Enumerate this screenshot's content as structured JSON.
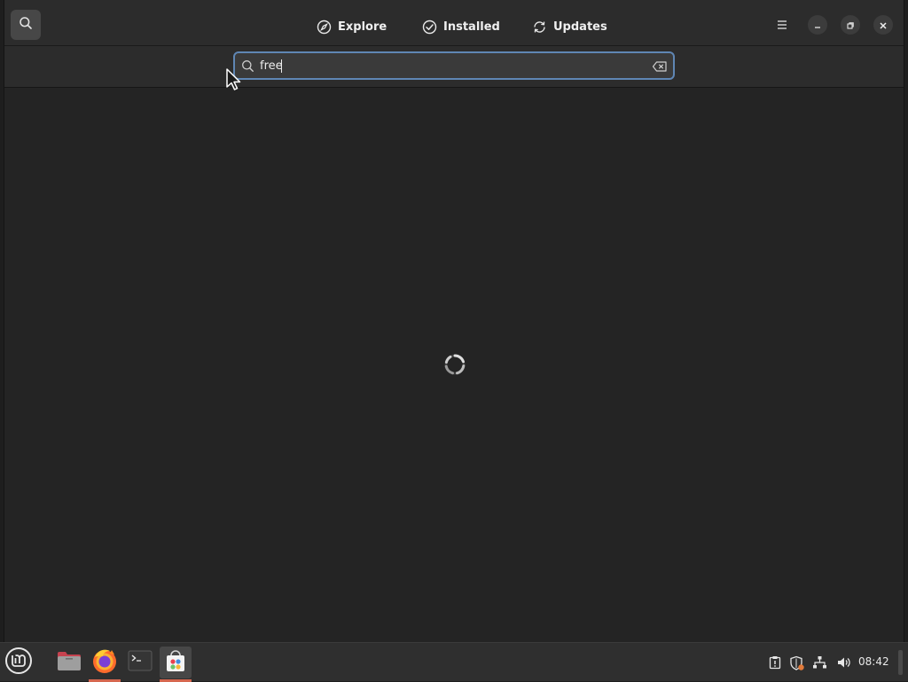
{
  "header": {
    "tabs": [
      {
        "label": "Explore",
        "icon": "compass-icon"
      },
      {
        "label": "Installed",
        "icon": "check-circle-icon"
      },
      {
        "label": "Updates",
        "icon": "refresh-icon"
      }
    ],
    "menu_icon": "hamburger-menu-icon",
    "window_controls": [
      "minimize-icon",
      "restore-icon",
      "close-icon"
    ]
  },
  "search": {
    "value": "free",
    "placeholder": ""
  },
  "content": {
    "state": "loading",
    "spinner_icon": "loading-spinner"
  },
  "taskbar": {
    "apps": [
      "menu-icon",
      "files-icon",
      "firefox-icon",
      "terminal-icon",
      "software-manager-icon"
    ],
    "active_app": "software-manager-icon",
    "tray": [
      "clipboard-icon",
      "shield-update-icon",
      "network-icon",
      "volume-icon"
    ],
    "clock": "08:42"
  },
  "colors": {
    "accent": "#5f86b4",
    "active_underline": "#d5674f",
    "background": "#242424",
    "headerbar": "#2c2c2c"
  }
}
